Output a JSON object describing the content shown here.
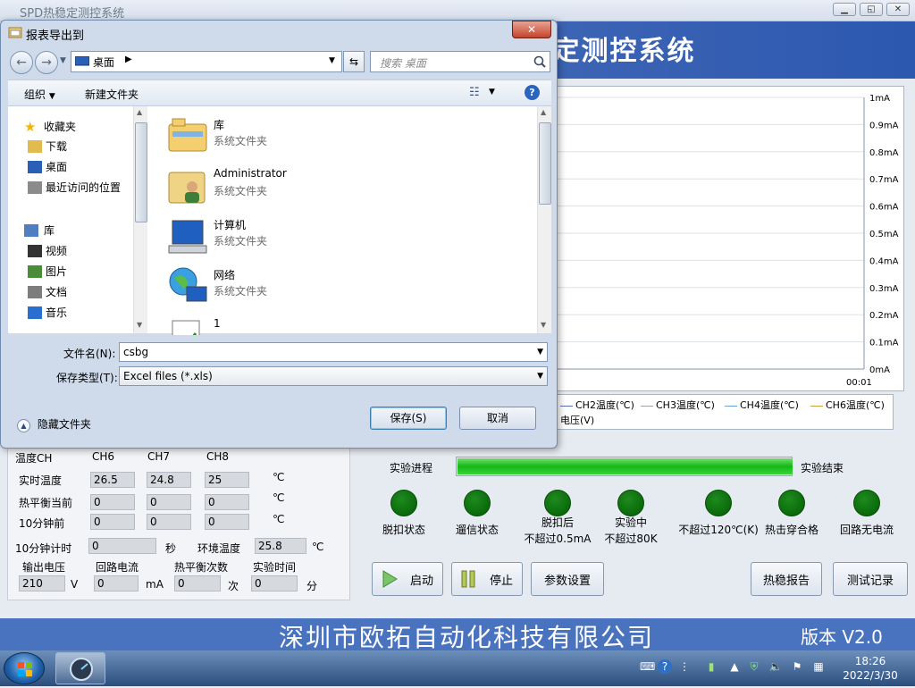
{
  "main_window": {
    "title": "SPD热稳定测控系统",
    "banner_title": "SPD热稳定测控系统",
    "buttons": {
      "minimize": "▁",
      "maximize": "◱",
      "close": "✕"
    }
  },
  "chart_data": {
    "type": "line",
    "title": "",
    "x": [
      "00:01"
    ],
    "y_ticks": [
      "1mA",
      "0.9mA",
      "0.8mA",
      "0.7mA",
      "0.6mA",
      "0.5mA",
      "0.4mA",
      "0.3mA",
      "0.2mA",
      "0.1mA",
      "0mA"
    ],
    "ylim": [
      0,
      1
    ],
    "yunit": "mA",
    "series": [
      {
        "name": "CH2温度(℃)",
        "values": [],
        "color": "#5b6fb3"
      },
      {
        "name": "CH3温度(℃)",
        "values": [],
        "color": "#a0a0a0"
      },
      {
        "name": "CH4温度(℃)",
        "values": [],
        "color": "#6aa0d8"
      },
      {
        "name": "CH6温度(℃)",
        "values": [],
        "color": "#c9a13a"
      },
      {
        "name": "电压(V)",
        "values": [],
        "color": "#b0b0b0"
      }
    ]
  },
  "data_panel": {
    "header": {
      "label": "温度CH",
      "cols": [
        "CH6",
        "CH7",
        "CH8"
      ]
    },
    "rows": [
      {
        "label": "实时温度",
        "values": [
          "26.5",
          "24.8",
          "25"
        ],
        "unit": "℃"
      },
      {
        "label": "热平衡当前",
        "values": [
          "0",
          "0",
          "0"
        ],
        "unit": "℃"
      },
      {
        "label": "10分钟前",
        "values": [
          "0",
          "0",
          "0"
        ],
        "unit": "℃"
      }
    ],
    "timer_label": "10分钟计时",
    "timer_value": "0",
    "timer_unit": "秒",
    "ambient_label": "环境温度",
    "ambient_value": "25.8",
    "ambient_unit": "℃",
    "fields": [
      {
        "label": "输出电压",
        "value": "210",
        "unit": "V"
      },
      {
        "label": "回路电流",
        "value": "0",
        "unit": "mA"
      },
      {
        "label": "热平衡次数",
        "value": "0",
        "unit": "次"
      },
      {
        "label": "实验时间",
        "value": "0",
        "unit": "分"
      }
    ]
  },
  "progress": {
    "label": "实验进程",
    "value": 1.0,
    "end_label": "实验结束"
  },
  "indicators": [
    {
      "lines": [
        "脱扣状态"
      ]
    },
    {
      "lines": [
        "遛信状态"
      ]
    },
    {
      "lines": [
        "脱扣后",
        "不超过0.5mA"
      ]
    },
    {
      "lines": [
        "实验中",
        "不超过80K"
      ]
    },
    {
      "lines": [
        "不超过120℃(K)"
      ]
    },
    {
      "lines": [
        "热击穿合格"
      ]
    },
    {
      "lines": [
        "回路无电流"
      ]
    }
  ],
  "controls": {
    "start": "启动",
    "stop": "停止",
    "params": "参数设置",
    "report": "热稳报告",
    "records": "测试记录"
  },
  "footer": {
    "company": "深圳市欧拓自动化科技有限公司",
    "version": "版本 V2.0"
  },
  "taskbar": {
    "time": "18:26",
    "date": "2022/3/30"
  },
  "dialog": {
    "title": "报表导出到",
    "address": "桌面",
    "search_placeholder": "搜索 桌面",
    "toolbar": {
      "organize": "组织",
      "new_folder": "新建文件夹"
    },
    "nav": [
      {
        "label": "收藏夹",
        "icon": "star-icon"
      },
      {
        "label": "下载",
        "icon": "download-folder-icon"
      },
      {
        "label": "桌面",
        "icon": "desktop-icon"
      },
      {
        "label": "最近访问的位置",
        "icon": "recent-places-icon"
      },
      {
        "label": "库",
        "icon": "library-icon"
      },
      {
        "label": "视频",
        "icon": "video-icon"
      },
      {
        "label": "图片",
        "icon": "pictures-icon"
      },
      {
        "label": "文档",
        "icon": "documents-icon"
      },
      {
        "label": "音乐",
        "icon": "music-icon"
      }
    ],
    "files": [
      {
        "name": "库",
        "type": "系统文件夹",
        "icon": "library-folder-icon"
      },
      {
        "name": "Administrator",
        "type": "系统文件夹",
        "icon": "user-folder-icon"
      },
      {
        "name": "计算机",
        "type": "系统文件夹",
        "icon": "computer-icon"
      },
      {
        "name": "网络",
        "type": "系统文件夹",
        "icon": "network-icon"
      },
      {
        "name": "1",
        "type": "",
        "icon": "excel-file-icon"
      }
    ],
    "filename_label": "文件名(N):",
    "filename_value": "csbg",
    "filetype_label": "保存类型(T):",
    "filetype_value": "Excel files (*.xls)",
    "hide_folders": "隐藏文件夹",
    "save": "保存(S)",
    "cancel": "取消"
  }
}
